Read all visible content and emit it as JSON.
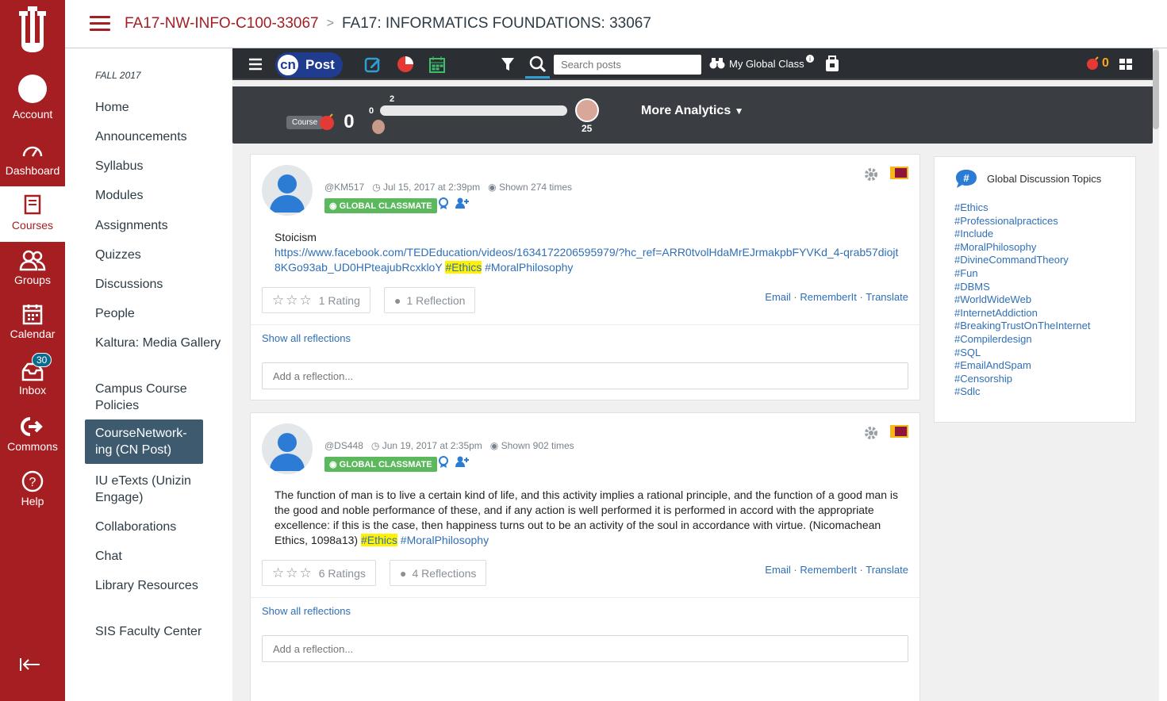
{
  "global_nav": {
    "items": [
      {
        "label": "Account",
        "icon": "account-avatar-icon"
      },
      {
        "label": "Dashboard",
        "icon": "dashboard-icon"
      },
      {
        "label": "Courses",
        "icon": "courses-icon",
        "active": true
      },
      {
        "label": "Groups",
        "icon": "groups-icon"
      },
      {
        "label": "Calendar",
        "icon": "calendar-icon"
      },
      {
        "label": "Inbox",
        "icon": "inbox-icon",
        "badge": "30"
      },
      {
        "label": "Commons",
        "icon": "commons-icon"
      },
      {
        "label": "Help",
        "icon": "help-icon"
      }
    ]
  },
  "header": {
    "course_code": "FA17-NW-INFO-C100-33067",
    "separator": ">",
    "current": "FA17: INFORMATICS FOUNDATIONS: 33067"
  },
  "course_nav": {
    "term": "FALL 2017",
    "items": [
      "Home",
      "Announcements",
      "Syllabus",
      "Modules",
      "Assignments",
      "Quizzes",
      "Discussions",
      "People",
      "Kaltura: Media Gallery",
      "Campus Course Policies",
      "CourseNetwork-ing (CN Post)",
      "IU eTexts (Unizin Engage)",
      "Collaborations",
      "Chat",
      "Library Resources",
      "SIS Faculty Center"
    ],
    "active_index": 10
  },
  "toolbar": {
    "logo_text": "Post",
    "logo_mark": "cn",
    "search_placeholder": "Search posts",
    "my_global_class": "My Global Class",
    "score": "0"
  },
  "analytics": {
    "course_label": "Course",
    "course_score": "0",
    "bar_left_label": "0",
    "bar_top_label": "2",
    "peer_score": "25",
    "more_label": "More Analytics"
  },
  "posts": [
    {
      "user": "@KM517",
      "date": "Jul 15, 2017 at 2:39pm",
      "shown": "Shown 274 times",
      "badge": "GLOBAL CLASSMATE",
      "title": "Stoicism",
      "link": "https://www.facebook.com/TEDEducation/videos/1634172206595979/?hc_ref=ARR0tvolHdaMrEJrmakpbFYVKd_4-qrab57diojt8KGo93ab_UD0HPteajubRcxkloY",
      "tag1": "#Ethics",
      "tag2": "#MoralPhilosophy",
      "rating": "1 Rating",
      "reflection": "1 Reflection",
      "actions": {
        "email": "Email",
        "remember": "RememberIt",
        "translate": "Translate"
      },
      "show_all": "Show all reflections",
      "reflect_placeholder": "Add a reflection..."
    },
    {
      "user": "@DS448",
      "date": "Jun 19, 2017 at 2:35pm",
      "shown": "Shown 902 times",
      "badge": "GLOBAL CLASSMATE",
      "text": "The function of man is to live a certain kind of life, and this activity implies a rational principle, and the function of a good man is the good and noble performance of these, and if any action is well performed it is performed in accord with the appropriate excellence: if this is the case, then happiness turns out to be an activity of the soul in accordance with virtue. (Nicomachean Ethics, 1098a13)",
      "tag1": "#Ethics",
      "tag2": "#MoralPhilosophy",
      "rating": "6 Ratings",
      "reflection": "4 Reflections",
      "actions": {
        "email": "Email",
        "remember": "RememberIt",
        "translate": "Translate"
      },
      "show_all": "Show all reflections",
      "reflect_placeholder": "Add a reflection..."
    }
  ],
  "topics": {
    "title": "Global Discussion Topics",
    "items": [
      "#Ethics",
      "#Professionalpractices",
      "#Include",
      "#MoralPhilosophy",
      "#DivineCommandTheory",
      "#Fun",
      "#DBMS",
      "#WorldWideWeb",
      "#InternetAddiction",
      "#BreakingTrustOnTheInternet",
      "#Compilerdesign",
      "#SQL",
      "#EmailAndSpam",
      "#Censorship",
      "#Sdlc"
    ]
  },
  "colors": {
    "brand_red": "#a51e22",
    "active_nav": "#3d5a6e",
    "link": "#2f6fb7",
    "badge_green": "#5cb85c",
    "toolbar_dark": "#2b2e33"
  }
}
